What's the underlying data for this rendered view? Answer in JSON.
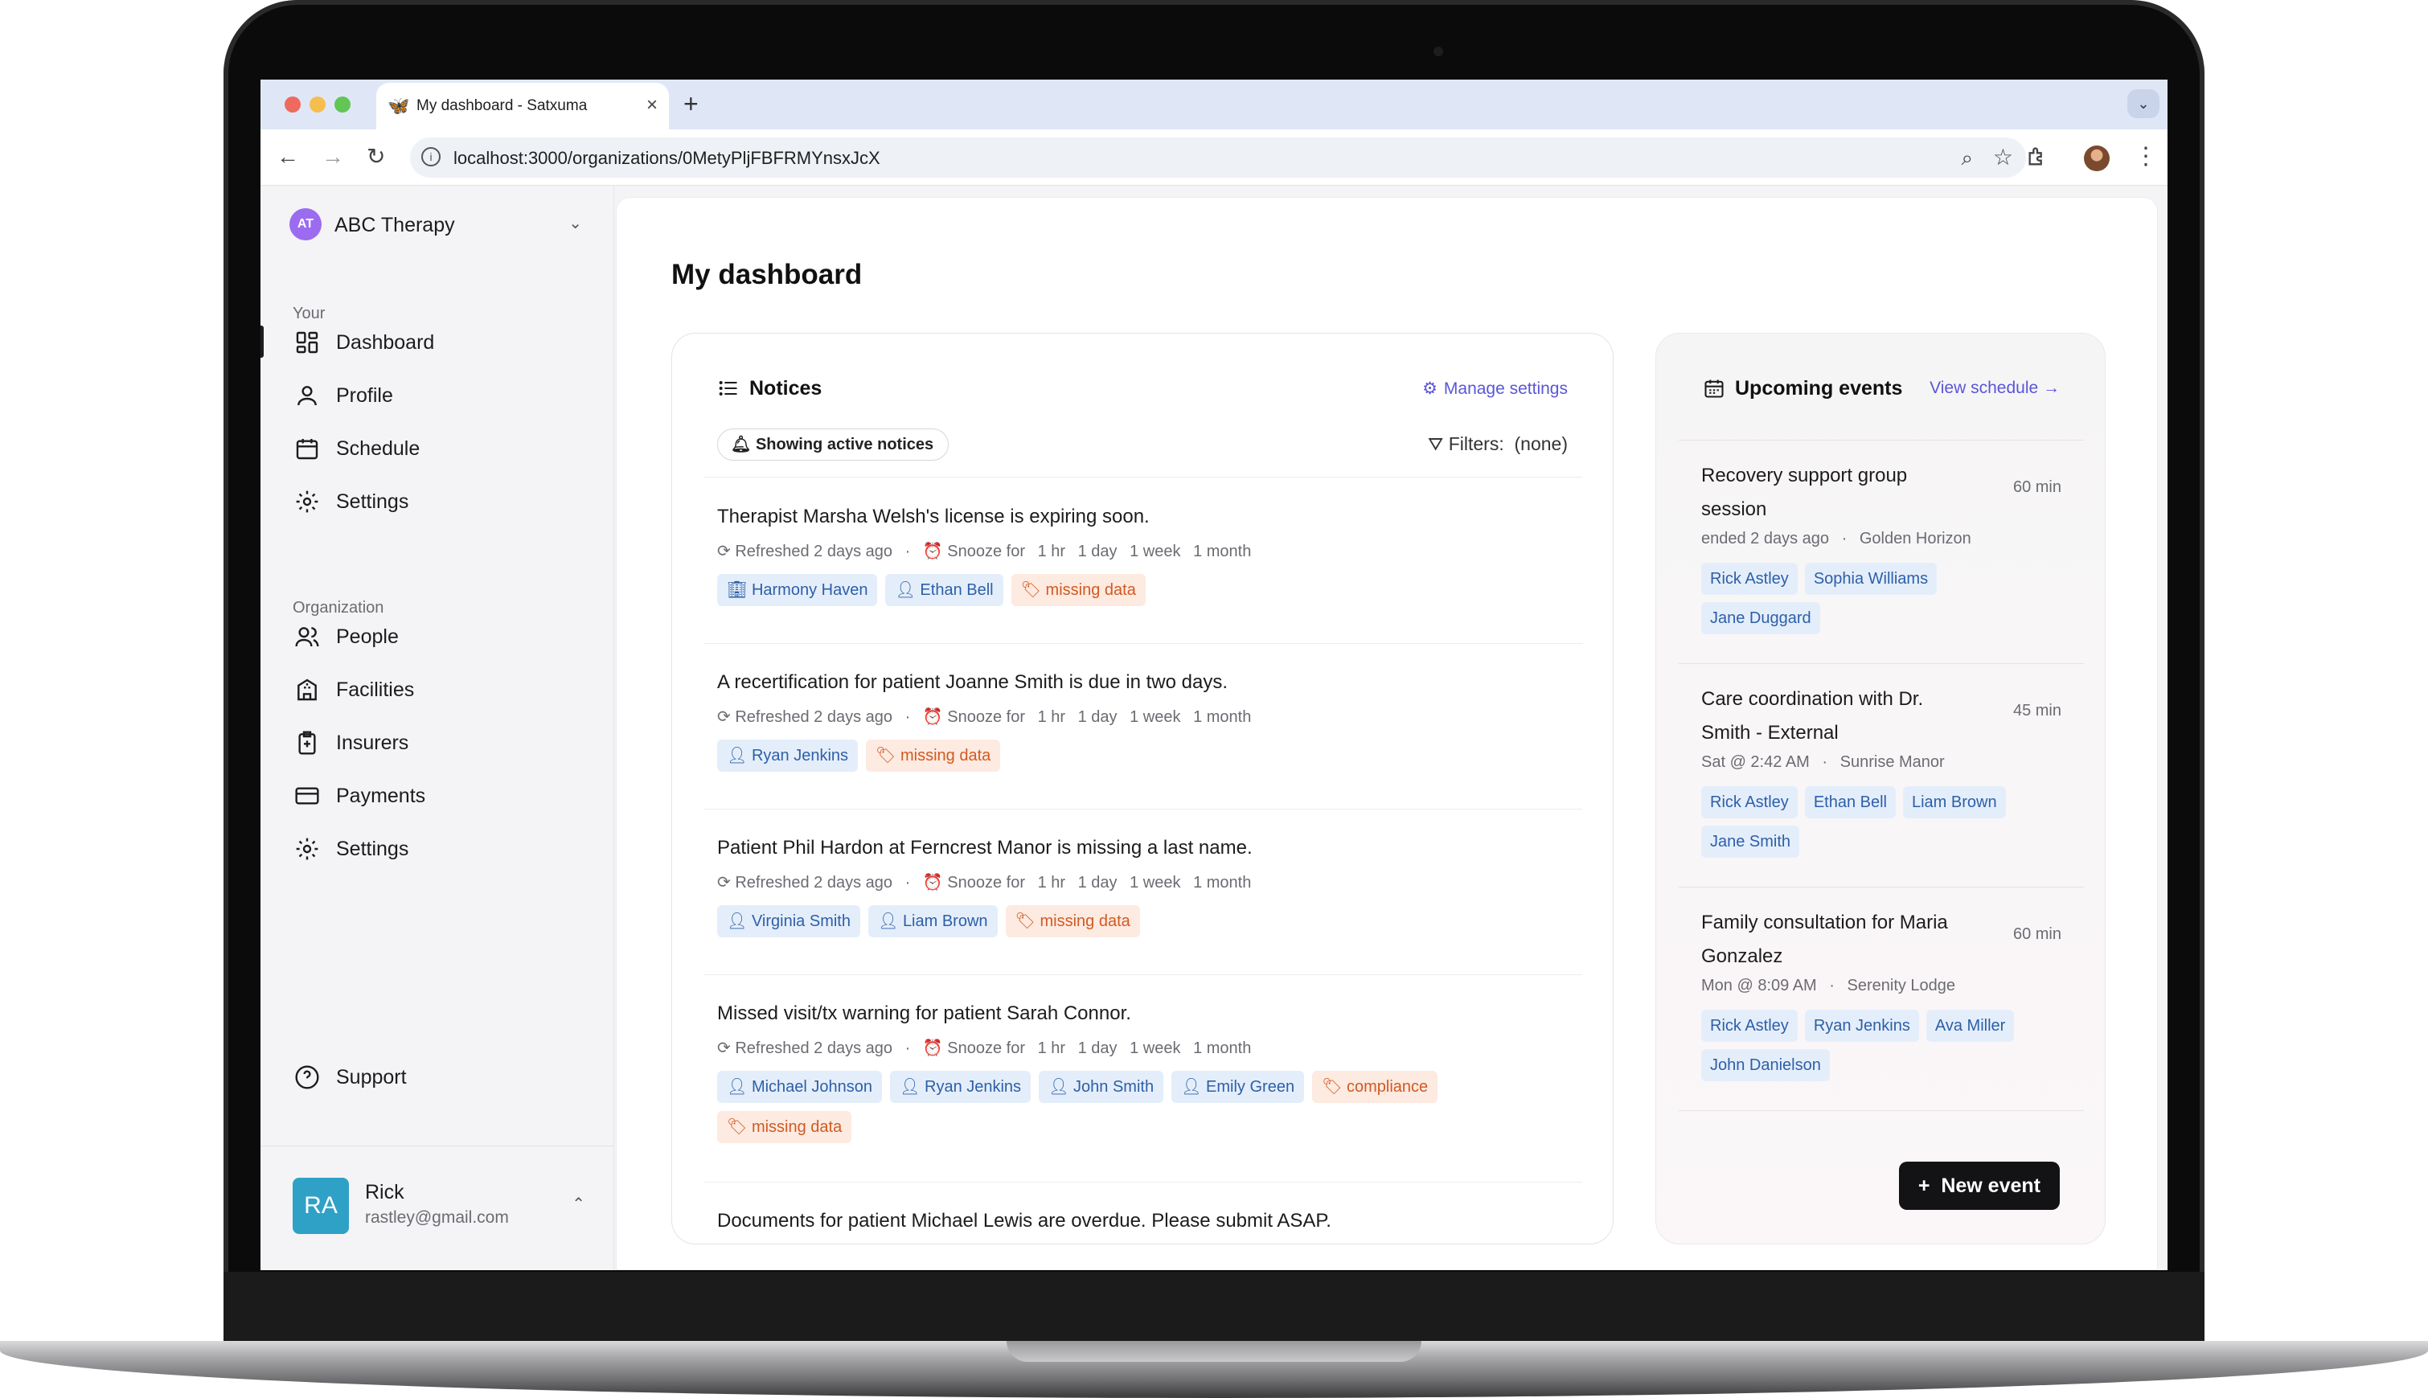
{
  "browser": {
    "tab_title": "My dashboard - Satxuma",
    "url": "localhost:3000/organizations/0MetyPljFBFRMYnsxJcX"
  },
  "sidebar": {
    "org": {
      "initials": "AT",
      "name": "ABC Therapy"
    },
    "your_label": "Your",
    "your_items": [
      {
        "label": "Dashboard",
        "icon": "dashboard-icon",
        "active": true
      },
      {
        "label": "Profile",
        "icon": "user-icon"
      },
      {
        "label": "Schedule",
        "icon": "calendar-icon"
      },
      {
        "label": "Settings",
        "icon": "gear-icon"
      }
    ],
    "org_label": "Organization",
    "org_items": [
      {
        "label": "People",
        "icon": "people-icon"
      },
      {
        "label": "Facilities",
        "icon": "building-icon"
      },
      {
        "label": "Insurers",
        "icon": "clipboard-plus-icon"
      },
      {
        "label": "Payments",
        "icon": "credit-card-icon"
      },
      {
        "label": "Settings",
        "icon": "gear-icon"
      }
    ],
    "support_label": "Support",
    "user": {
      "initials": "RA",
      "name": "Rick",
      "email": "rastley@gmail.com"
    }
  },
  "page": {
    "title": "My dashboard"
  },
  "notices": {
    "title": "Notices",
    "manage_settings": "Manage settings",
    "active_pill": "Showing active notices",
    "filters_label": "Filters:",
    "filters_value": "(none)",
    "refreshed_prefix": "Refreshed",
    "snooze_label": "Snooze for",
    "snooze_options": [
      "1 hr",
      "1 day",
      "1 week",
      "1 month"
    ],
    "items": [
      {
        "text": "Therapist Marsha Welsh's license is expiring soon.",
        "refreshed": "2 days ago",
        "tags": [
          {
            "kind": "facility",
            "label": "Harmony Haven"
          },
          {
            "kind": "person",
            "label": "Ethan Bell"
          },
          {
            "kind": "flag",
            "label": "missing data"
          }
        ]
      },
      {
        "text": "A recertification for patient Joanne Smith is due in two days.",
        "refreshed": "2 days ago",
        "tags": [
          {
            "kind": "person",
            "label": "Ryan Jenkins"
          },
          {
            "kind": "flag",
            "label": "missing data"
          }
        ]
      },
      {
        "text": "Patient Phil Hardon at Ferncrest Manor is missing a last name.",
        "refreshed": "2 days ago",
        "tags": [
          {
            "kind": "person",
            "label": "Virginia Smith"
          },
          {
            "kind": "person",
            "label": "Liam Brown"
          },
          {
            "kind": "flag",
            "label": "missing data"
          }
        ]
      },
      {
        "text": "Missed visit/tx warning for patient Sarah Connor.",
        "refreshed": "2 days ago",
        "tags": [
          {
            "kind": "person",
            "label": "Michael Johnson"
          },
          {
            "kind": "person",
            "label": "Ryan Jenkins"
          },
          {
            "kind": "person",
            "label": "John Smith"
          },
          {
            "kind": "person",
            "label": "Emily Green"
          },
          {
            "kind": "flag",
            "label": "compliance"
          },
          {
            "kind": "flag",
            "label": "missing data"
          }
        ]
      },
      {
        "text": "Documents for patient Michael Lewis are overdue. Please submit ASAP.",
        "refreshed": "",
        "tags": []
      }
    ]
  },
  "events": {
    "title": "Upcoming events",
    "view_schedule": "View schedule →",
    "items": [
      {
        "title": "Recovery support group session",
        "duration": "60 min",
        "when": "ended 2 days ago",
        "place": "Golden Horizon",
        "people": [
          "Rick Astley",
          "Sophia Williams",
          "Jane Duggard"
        ]
      },
      {
        "title": "Care coordination with Dr. Smith - External",
        "duration": "45 min",
        "when": "Sat @ 2:42 AM",
        "place": "Sunrise Manor",
        "people": [
          "Rick Astley",
          "Ethan Bell",
          "Liam Brown",
          "Jane Smith"
        ]
      },
      {
        "title": "Family consultation for Maria Gonzalez",
        "duration": "60 min",
        "when": "Mon @ 8:09 AM",
        "place": "Serenity Lodge",
        "people": [
          "Rick Astley",
          "Ryan Jenkins",
          "Ava Miller",
          "John Danielson"
        ]
      }
    ],
    "new_event": "New event"
  },
  "colors": {
    "accent": "#5a56d6",
    "entity_tag_bg": "#e4eefa",
    "entity_tag_text": "#2d5fa8",
    "flag_tag_bg": "#fdeae0",
    "flag_tag_text": "#d05a23",
    "org_avatar": "#9b6cf0",
    "user_avatar": "#2fa1c6"
  }
}
